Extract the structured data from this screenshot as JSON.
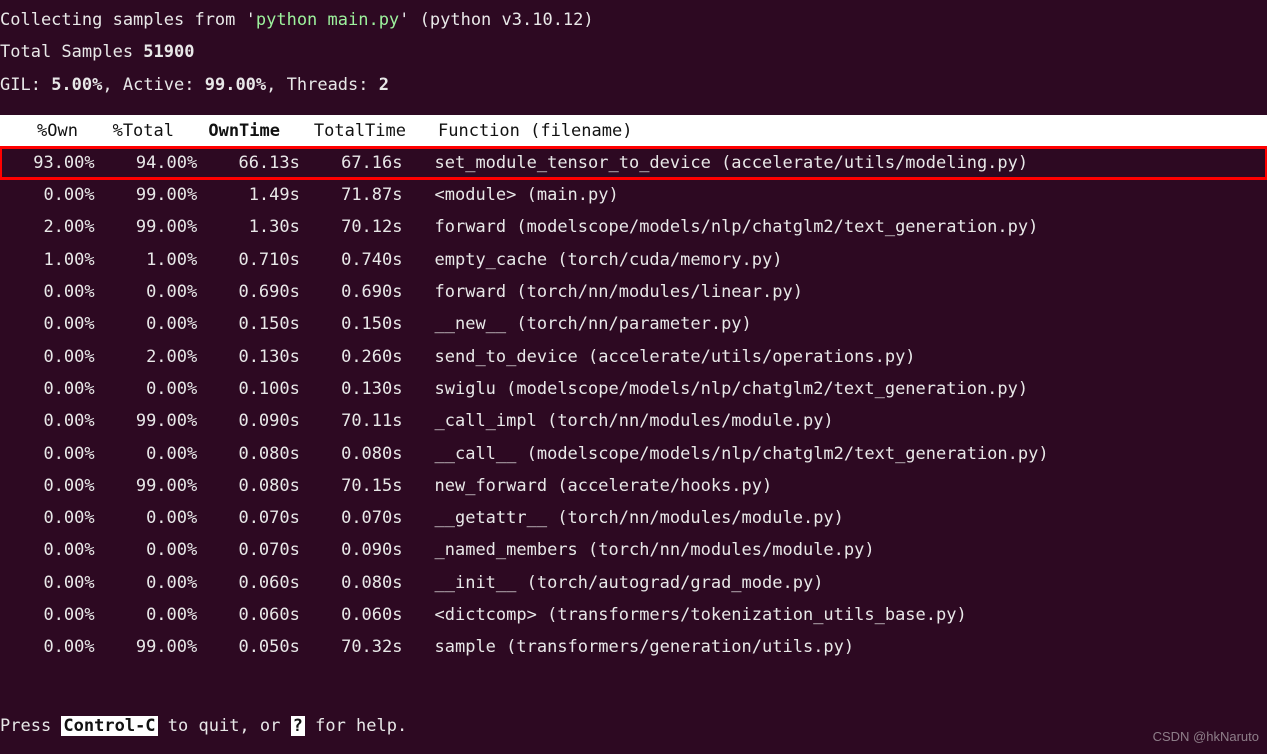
{
  "header": {
    "collect_prefix": "Collecting samples from '",
    "command": "python main.py",
    "collect_suffix": "' (python v3.10.12)",
    "total_label": "Total Samples ",
    "total_value": "51900",
    "gil_label": "GIL: ",
    "gil_value": "5.00%",
    "active_label": ", Active: ",
    "active_value": "99.00%",
    "threads_label": ", Threads: ",
    "threads_value": "2"
  },
  "columns": {
    "own_pct": "%Own",
    "total_pct": "%Total",
    "own_time": "OwnTime",
    "total_time": "TotalTime",
    "func": "Function (filename)"
  },
  "rows": [
    {
      "own_pct": "93.00%",
      "total_pct": "94.00%",
      "own_time": "66.13s",
      "total_time": "67.16s",
      "func": "set_module_tensor_to_device (accelerate/utils/modeling.py)",
      "hl": true
    },
    {
      "own_pct": "0.00%",
      "total_pct": "99.00%",
      "own_time": "1.49s",
      "total_time": "71.87s",
      "func": "<module> (main.py)"
    },
    {
      "own_pct": "2.00%",
      "total_pct": "99.00%",
      "own_time": "1.30s",
      "total_time": "70.12s",
      "func": "forward (modelscope/models/nlp/chatglm2/text_generation.py)"
    },
    {
      "own_pct": "1.00%",
      "total_pct": "1.00%",
      "own_time": "0.710s",
      "total_time": "0.740s",
      "func": "empty_cache (torch/cuda/memory.py)"
    },
    {
      "own_pct": "0.00%",
      "total_pct": "0.00%",
      "own_time": "0.690s",
      "total_time": "0.690s",
      "func": "forward (torch/nn/modules/linear.py)"
    },
    {
      "own_pct": "0.00%",
      "total_pct": "0.00%",
      "own_time": "0.150s",
      "total_time": "0.150s",
      "func": "__new__ (torch/nn/parameter.py)"
    },
    {
      "own_pct": "0.00%",
      "total_pct": "2.00%",
      "own_time": "0.130s",
      "total_time": "0.260s",
      "func": "send_to_device (accelerate/utils/operations.py)"
    },
    {
      "own_pct": "0.00%",
      "total_pct": "0.00%",
      "own_time": "0.100s",
      "total_time": "0.130s",
      "func": "swiglu (modelscope/models/nlp/chatglm2/text_generation.py)"
    },
    {
      "own_pct": "0.00%",
      "total_pct": "99.00%",
      "own_time": "0.090s",
      "total_time": "70.11s",
      "func": "_call_impl (torch/nn/modules/module.py)"
    },
    {
      "own_pct": "0.00%",
      "total_pct": "0.00%",
      "own_time": "0.080s",
      "total_time": "0.080s",
      "func": "__call__ (modelscope/models/nlp/chatglm2/text_generation.py)"
    },
    {
      "own_pct": "0.00%",
      "total_pct": "99.00%",
      "own_time": "0.080s",
      "total_time": "70.15s",
      "func": "new_forward (accelerate/hooks.py)"
    },
    {
      "own_pct": "0.00%",
      "total_pct": "0.00%",
      "own_time": "0.070s",
      "total_time": "0.070s",
      "func": "__getattr__ (torch/nn/modules/module.py)"
    },
    {
      "own_pct": "0.00%",
      "total_pct": "0.00%",
      "own_time": "0.070s",
      "total_time": "0.090s",
      "func": "_named_members (torch/nn/modules/module.py)"
    },
    {
      "own_pct": "0.00%",
      "total_pct": "0.00%",
      "own_time": "0.060s",
      "total_time": "0.080s",
      "func": "__init__ (torch/autograd/grad_mode.py)"
    },
    {
      "own_pct": "0.00%",
      "total_pct": "0.00%",
      "own_time": "0.060s",
      "total_time": "0.060s",
      "func": "<dictcomp> (transformers/tokenization_utils_base.py)"
    },
    {
      "own_pct": "0.00%",
      "total_pct": "99.00%",
      "own_time": "0.050s",
      "total_time": "70.32s",
      "func": "sample (transformers/generation/utils.py)"
    }
  ],
  "footer": {
    "press": "Press ",
    "key1": "Control-C",
    "mid": " to quit, or ",
    "key2": "?",
    "end": " for help."
  },
  "watermark": "CSDN @hkNaruto"
}
